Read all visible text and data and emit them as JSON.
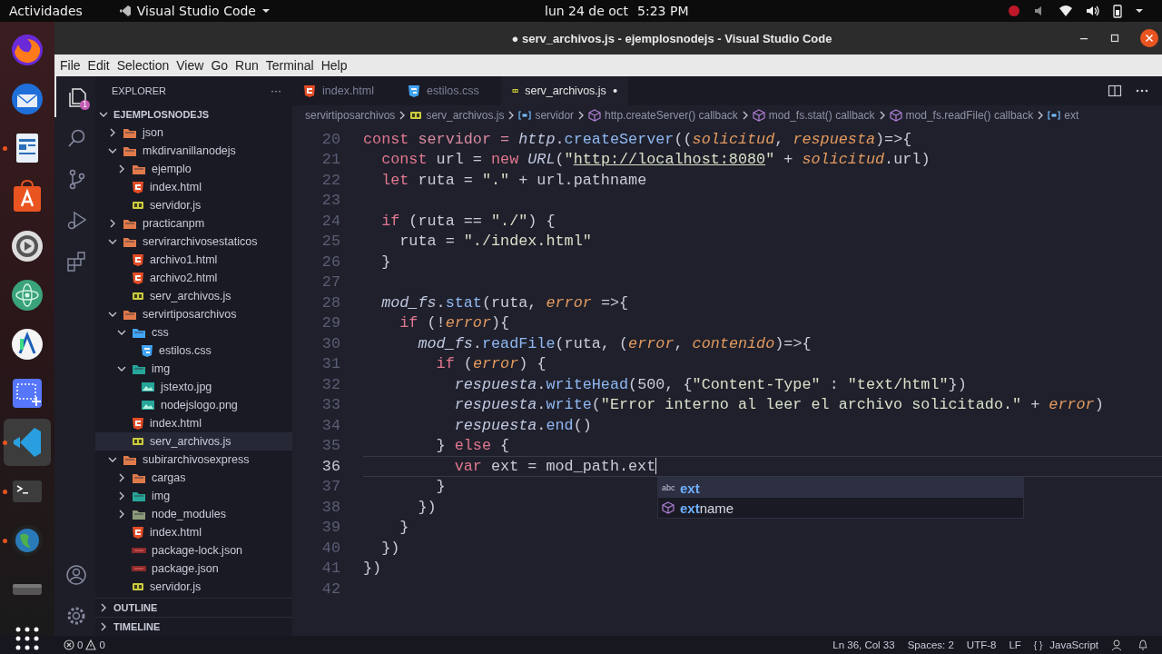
{
  "top_bar": {
    "activities": "Actividades",
    "app_menu": "Visual Studio Code",
    "date": "lun 24 de oct",
    "time": "5:23 PM"
  },
  "dock": [
    {
      "kind": "browser",
      "running": false,
      "selected": false
    },
    {
      "kind": "mail",
      "running": false,
      "selected": false
    },
    {
      "kind": "document",
      "running": true,
      "selected": false
    },
    {
      "kind": "store",
      "running": false,
      "selected": false
    },
    {
      "kind": "media",
      "running": false,
      "selected": false
    },
    {
      "kind": "atom",
      "running": false,
      "selected": false
    },
    {
      "kind": "studio",
      "running": false,
      "selected": false
    },
    {
      "kind": "screenshot",
      "running": false,
      "selected": false
    },
    {
      "kind": "editor",
      "running": true,
      "selected": true
    },
    {
      "kind": "terminal",
      "running": true,
      "selected": false
    },
    {
      "kind": "globe",
      "running": true,
      "selected": false
    },
    {
      "kind": "drive",
      "running": false,
      "selected": false
    },
    {
      "kind": "apps",
      "running": false,
      "selected": false
    }
  ],
  "window": {
    "title": "● serv_archivos.js - ejemplosnodejs - Visual Studio Code"
  },
  "menu": [
    "File",
    "Edit",
    "Selection",
    "View",
    "Go",
    "Run",
    "Terminal",
    "Help"
  ],
  "activity_bar": [
    {
      "kind": "explorer",
      "selected": true,
      "badge": "1"
    },
    {
      "kind": "search",
      "selected": false
    },
    {
      "kind": "source-control",
      "selected": false
    },
    {
      "kind": "run",
      "selected": false
    },
    {
      "kind": "extensions",
      "selected": false
    }
  ],
  "activity_bar_bottom": [
    {
      "kind": "account"
    },
    {
      "kind": "settings"
    }
  ],
  "sidebar": {
    "title": "EXPLORER",
    "more": "···",
    "root": "EJEMPLOSNODEJS",
    "tree": [
      {
        "name": "json",
        "kind": "folder",
        "color": "#e07a4b",
        "expanded": false,
        "selected": false
      },
      {
        "name": "mkdirvanillanodejs",
        "kind": "folder",
        "color": "#e07a4b",
        "expanded": true,
        "selected": false,
        "children": [
          {
            "name": "ejemplo",
            "kind": "folder",
            "color": "#e07a4b",
            "expanded": false,
            "selected": false
          },
          {
            "name": "index.html",
            "kind": "html",
            "selected": false
          },
          {
            "name": "servidor.js",
            "kind": "js",
            "selected": false
          }
        ]
      },
      {
        "name": "practicanpm",
        "kind": "folder",
        "color": "#e07a4b",
        "expanded": false,
        "selected": false
      },
      {
        "name": "servirarchivosestaticos",
        "kind": "folder",
        "color": "#e07a4b",
        "expanded": true,
        "selected": false,
        "children": [
          {
            "name": "archivo1.html",
            "kind": "html",
            "selected": false
          },
          {
            "name": "archivo2.html",
            "kind": "html",
            "selected": false
          },
          {
            "name": "serv_archivos.js",
            "kind": "js",
            "selected": false
          }
        ]
      },
      {
        "name": "servirtiposarchivos",
        "kind": "folder",
        "color": "#e07a4b",
        "expanded": true,
        "selected": false,
        "children": [
          {
            "name": "css",
            "kind": "folder",
            "color": "#42a5f5",
            "expanded": true,
            "selected": false,
            "children": [
              {
                "name": "estilos.css",
                "kind": "css",
                "selected": false
              }
            ]
          },
          {
            "name": "img",
            "kind": "folder",
            "color": "#26a69a",
            "expanded": true,
            "selected": false,
            "children": [
              {
                "name": "jstexto.jpg",
                "kind": "image",
                "selected": false
              },
              {
                "name": "nodejslogo.png",
                "kind": "image",
                "selected": false
              }
            ]
          },
          {
            "name": "index.html",
            "kind": "html",
            "selected": false
          },
          {
            "name": "serv_archivos.js",
            "kind": "js",
            "selected": true
          }
        ]
      },
      {
        "name": "subirarchivosexpress",
        "kind": "folder",
        "color": "#e07a4b",
        "expanded": true,
        "selected": false,
        "children": [
          {
            "name": "cargas",
            "kind": "folder",
            "color": "#e07a4b",
            "expanded": false,
            "selected": false
          },
          {
            "name": "img",
            "kind": "folder",
            "color": "#26a69a",
            "expanded": false,
            "selected": false
          },
          {
            "name": "node_modules",
            "kind": "folder",
            "color": "#8d9a7a",
            "expanded": false,
            "selected": false
          },
          {
            "name": "index.html",
            "kind": "html",
            "selected": false
          },
          {
            "name": "package-lock.json",
            "kind": "npm",
            "selected": false
          },
          {
            "name": "package.json",
            "kind": "npm",
            "selected": false
          },
          {
            "name": "servidor.js",
            "kind": "js",
            "selected": false
          }
        ]
      }
    ],
    "sections": [
      "OUTLINE",
      "TIMELINE"
    ]
  },
  "tabs": [
    {
      "label": "index.html",
      "kind": "html",
      "selected": false,
      "modified": false
    },
    {
      "label": "estilos.css",
      "kind": "css",
      "selected": false,
      "modified": false
    },
    {
      "label": "serv_archivos.js",
      "kind": "js",
      "selected": true,
      "modified": true
    }
  ],
  "breadcrumb": [
    {
      "label": "servirtiposarchivos",
      "kind": "folder"
    },
    {
      "label": "serv_archivos.js",
      "kind": "js"
    },
    {
      "label": "servidor",
      "kind": "variable"
    },
    {
      "label": "http.createServer() callback",
      "kind": "function"
    },
    {
      "label": "mod_fs.stat() callback",
      "kind": "function"
    },
    {
      "label": "mod_fs.readFile() callback",
      "kind": "function"
    },
    {
      "label": "ext",
      "kind": "variable"
    }
  ],
  "code": [
    {
      "number": "20",
      "current": false,
      "tokens": [
        {
          "kind": "kw",
          "text": "const"
        },
        {
          "kind": "var",
          "text": " servidor = "
        },
        {
          "kind": "obj",
          "text": "http"
        },
        {
          "kind": "plain",
          "text": "."
        },
        {
          "kind": "fn",
          "text": "createServer"
        },
        {
          "kind": "plain",
          "text": "(("
        },
        {
          "kind": "param",
          "text": "solicitud"
        },
        {
          "kind": "plain",
          "text": ", "
        },
        {
          "kind": "param",
          "text": "respuesta"
        },
        {
          "kind": "plain",
          "text": ")=>{"
        }
      ]
    },
    {
      "number": "21",
      "current": false,
      "tokens": [
        {
          "kind": "kw",
          "text": "  const"
        },
        {
          "kind": "plain",
          "text": " url = "
        },
        {
          "kind": "kw",
          "text": "new "
        },
        {
          "kind": "obj",
          "text": "URL"
        },
        {
          "kind": "plain",
          "text": "("
        },
        {
          "kind": "str",
          "text": "\""
        },
        {
          "kind": "link",
          "text": "http://localhost:8080"
        },
        {
          "kind": "str",
          "text": "\""
        },
        {
          "kind": "plain",
          "text": " + "
        },
        {
          "kind": "param",
          "text": "solicitud"
        },
        {
          "kind": "plain",
          "text": ".url)"
        }
      ]
    },
    {
      "number": "22",
      "current": false,
      "tokens": [
        {
          "kind": "kw",
          "text": "  let"
        },
        {
          "kind": "plain",
          "text": " ruta = "
        },
        {
          "kind": "str",
          "text": "\".\""
        },
        {
          "kind": "plain",
          "text": " + url.pathname"
        }
      ]
    },
    {
      "number": "23",
      "current": false
    },
    {
      "number": "24",
      "current": false,
      "tokens": [
        {
          "kind": "kw",
          "text": "  if"
        },
        {
          "kind": "plain",
          "text": " (ruta == "
        },
        {
          "kind": "str",
          "text": "\"./\""
        },
        {
          "kind": "plain",
          "text": ") {"
        }
      ]
    },
    {
      "number": "25",
      "current": false,
      "tokens": [
        {
          "kind": "plain",
          "text": "    ruta = "
        },
        {
          "kind": "str",
          "text": "\"./index.html\""
        }
      ]
    },
    {
      "number": "26",
      "current": false,
      "tokens": [
        {
          "kind": "plain",
          "text": "  }"
        }
      ]
    },
    {
      "number": "27",
      "current": false
    },
    {
      "number": "28",
      "current": false,
      "tokens": [
        {
          "kind": "obj",
          "text": "  mod_fs"
        },
        {
          "kind": "plain",
          "text": "."
        },
        {
          "kind": "fn",
          "text": "stat"
        },
        {
          "kind": "plain",
          "text": "(ruta, "
        },
        {
          "kind": "param",
          "text": "error"
        },
        {
          "kind": "plain",
          "text": " =>{"
        }
      ]
    },
    {
      "number": "29",
      "current": false,
      "tokens": [
        {
          "kind": "kw",
          "text": "    if"
        },
        {
          "kind": "plain",
          "text": " (!"
        },
        {
          "kind": "param",
          "text": "error"
        },
        {
          "kind": "plain",
          "text": "){"
        }
      ]
    },
    {
      "number": "30",
      "current": false,
      "tokens": [
        {
          "kind": "obj",
          "text": "      mod_fs"
        },
        {
          "kind": "plain",
          "text": "."
        },
        {
          "kind": "fn",
          "text": "readFile"
        },
        {
          "kind": "plain",
          "text": "(ruta, ("
        },
        {
          "kind": "param",
          "text": "error"
        },
        {
          "kind": "plain",
          "text": ", "
        },
        {
          "kind": "param",
          "text": "contenido"
        },
        {
          "kind": "plain",
          "text": ")=>{"
        }
      ]
    },
    {
      "number": "31",
      "current": false,
      "tokens": [
        {
          "kind": "kw",
          "text": "        if"
        },
        {
          "kind": "plain",
          "text": " ("
        },
        {
          "kind": "param",
          "text": "error"
        },
        {
          "kind": "plain",
          "text": ") {"
        }
      ]
    },
    {
      "number": "32",
      "current": false,
      "tokens": [
        {
          "kind": "obj",
          "text": "          respuesta"
        },
        {
          "kind": "plain",
          "text": "."
        },
        {
          "kind": "fn",
          "text": "writeHead"
        },
        {
          "kind": "plain",
          "text": "(500, {"
        },
        {
          "kind": "str",
          "text": "\"Content-Type\""
        },
        {
          "kind": "plain",
          "text": " : "
        },
        {
          "kind": "str",
          "text": "\"text/html\""
        },
        {
          "kind": "plain",
          "text": "})"
        }
      ]
    },
    {
      "number": "33",
      "current": false,
      "tokens": [
        {
          "kind": "obj",
          "text": "          respuesta"
        },
        {
          "kind": "plain",
          "text": "."
        },
        {
          "kind": "fn",
          "text": "write"
        },
        {
          "kind": "plain",
          "text": "("
        },
        {
          "kind": "str",
          "text": "\"Error interno al leer el archivo solicitado.\""
        },
        {
          "kind": "plain",
          "text": " + "
        },
        {
          "kind": "param",
          "text": "error"
        },
        {
          "kind": "plain",
          "text": ")"
        }
      ]
    },
    {
      "number": "34",
      "current": false,
      "tokens": [
        {
          "kind": "obj",
          "text": "          respuesta"
        },
        {
          "kind": "plain",
          "text": "."
        },
        {
          "kind": "fn",
          "text": "end"
        },
        {
          "kind": "plain",
          "text": "()"
        }
      ]
    },
    {
      "number": "35",
      "current": false,
      "tokens": [
        {
          "kind": "plain",
          "text": "        } "
        },
        {
          "kind": "kw",
          "text": "else"
        },
        {
          "kind": "plain",
          "text": " {"
        }
      ]
    },
    {
      "number": "36",
      "current": true,
      "tokens": [
        {
          "kind": "kw",
          "text": "          var"
        },
        {
          "kind": "plain",
          "text": " ext = mod_path.ext"
        }
      ]
    },
    {
      "number": "37",
      "current": false,
      "tokens": [
        {
          "kind": "plain",
          "text": "        }"
        }
      ]
    },
    {
      "number": "38",
      "current": false,
      "tokens": [
        {
          "kind": "plain",
          "text": "      })"
        }
      ]
    },
    {
      "number": "39",
      "current": false,
      "tokens": [
        {
          "kind": "plain",
          "text": "    }"
        }
      ]
    },
    {
      "number": "40",
      "current": false,
      "tokens": [
        {
          "kind": "plain",
          "text": "  })"
        }
      ]
    },
    {
      "number": "41",
      "current": false,
      "tokens": [
        {
          "kind": "plain",
          "text": "})"
        }
      ]
    },
    {
      "number": "42",
      "current": false
    }
  ],
  "suggestions": [
    {
      "kind": "text",
      "icon": "abc",
      "label": "**ext**",
      "selected": true
    },
    {
      "kind": "method",
      "label": "**ext**name",
      "selected": false
    }
  ],
  "status_bar": {
    "errors": "0",
    "warnings": "0",
    "items": [
      "Ln 36, Col 33",
      "Spaces: 2",
      "UTF-8",
      "LF"
    ],
    "language_icon": "{ }",
    "language": "JavaScript"
  }
}
